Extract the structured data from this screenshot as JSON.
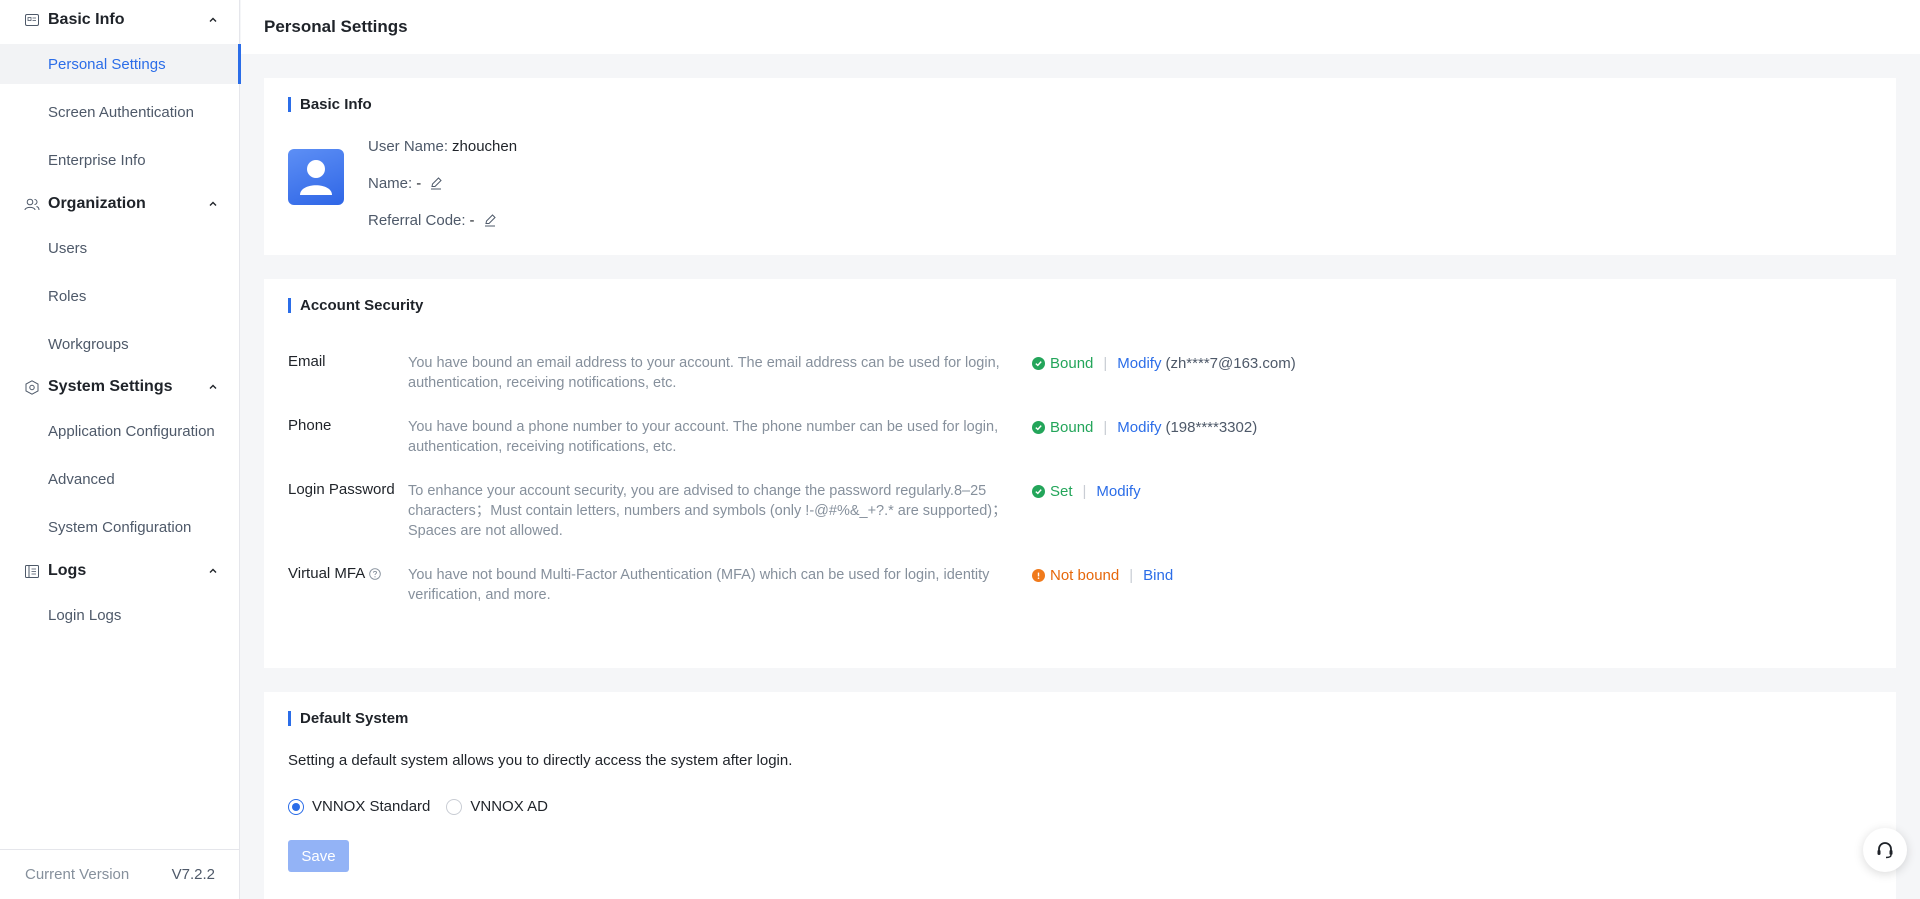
{
  "sidebar": {
    "groups": [
      {
        "label": "Basic Info",
        "icon": "id-card-icon",
        "items": [
          "Personal Settings",
          "Screen Authentication",
          "Enterprise Info"
        ]
      },
      {
        "label": "Organization",
        "icon": "users-icon",
        "items": [
          "Users",
          "Roles",
          "Workgroups"
        ]
      },
      {
        "label": "System Settings",
        "icon": "hexagon-settings-icon",
        "items": [
          "Application Configuration",
          "Advanced",
          "System Configuration"
        ]
      },
      {
        "label": "Logs",
        "icon": "log-book-icon",
        "items": [
          "Login Logs"
        ]
      }
    ],
    "active_item": "Personal Settings",
    "footer": {
      "label": "Current Version",
      "version": "V7.2.2"
    }
  },
  "header": {
    "title": "Personal Settings"
  },
  "basic_info": {
    "title": "Basic Info",
    "username_label": "User Name:",
    "username": "zhouchen",
    "name_label": "Name:",
    "name": "-",
    "referral_label": "Referral Code:",
    "referral": "-"
  },
  "account_security": {
    "title": "Account Security",
    "rows": [
      {
        "label": "Email",
        "desc": "You have bound an email address to your account. The email address can be used for login, authentication, receiving notifications, etc.",
        "status": "Bound",
        "action": "Modify",
        "masked": "(zh****7@163.com)"
      },
      {
        "label": "Phone",
        "desc": "You have bound a phone number to your account. The phone number can be used for login, authentication, receiving notifications, etc.",
        "status": "Bound",
        "action": "Modify",
        "masked": "(198****3302)"
      },
      {
        "label": "Login Password",
        "desc": "To enhance your account security, you are advised to change the password regularly.8–25 characters；Must contain letters, numbers and symbols (only !-@#%&_+?.* are supported)；Spaces are not allowed.",
        "status": "Set",
        "action": "Modify",
        "masked": ""
      },
      {
        "label": "Virtual MFA",
        "desc": "You have not bound Multi-Factor Authentication (MFA) which can be used for login, identity verification, and more.",
        "status": "Not bound",
        "action": "Bind",
        "masked": ""
      }
    ]
  },
  "default_system": {
    "title": "Default System",
    "desc": "Setting a default system allows you to directly access the system after login.",
    "options": [
      "VNNOX Standard",
      "VNNOX AD"
    ],
    "selected": "VNNOX Standard",
    "save_label": "Save"
  },
  "colors": {
    "accent": "#2b6de8",
    "ok": "#23a55a",
    "warn": "#e6670a"
  }
}
